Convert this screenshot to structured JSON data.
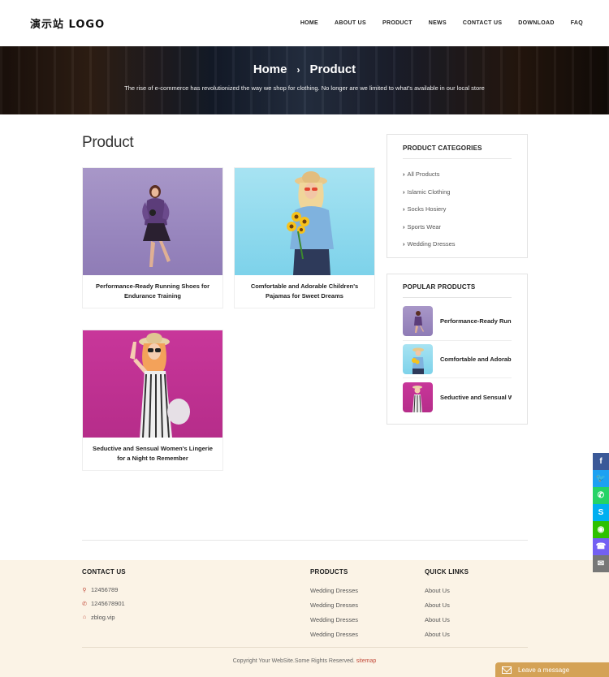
{
  "header": {
    "logo": "演示站 LOGO",
    "nav": [
      "HOME",
      "ABOUT US",
      "PRODUCT",
      "NEWS",
      "CONTACT US",
      "DOWNLOAD",
      "FAQ"
    ]
  },
  "banner": {
    "crumb_home": "Home",
    "crumb_sep": "›",
    "crumb_current": "Product",
    "subtitle": "The rise of e-commerce has revolutionized the way we shop for clothing. No longer are we limited to what's available in our local store"
  },
  "main": {
    "title": "Product",
    "products": [
      {
        "caption": "Performance-Ready Running Shoes for Endurance Training",
        "image": "woman-in-purple-coat-photo"
      },
      {
        "caption": "Comfortable and Adorable Children's Pajamas for Sweet Dreams",
        "image": "woman-with-sunflowers-photo"
      },
      {
        "caption": "Seductive and Sensual Women's Lingerie for a Night to Remember",
        "image": "woman-in-striped-jumpsuit-photo"
      }
    ]
  },
  "sidebar": {
    "categories_title": "PRODUCT CATEGORIES",
    "categories": [
      "All Products",
      "Islamic Clothing",
      "Socks Hosiery",
      "Sports Wear",
      "Wedding Dresses"
    ],
    "popular_title": "POPULAR PRODUCTS",
    "popular": [
      {
        "title": "Performance-Ready Running Shoes for Endurance Training"
      },
      {
        "title": "Comfortable and Adorable Children's Pajamas for Sweet Dreams"
      },
      {
        "title": "Seductive and Sensual Women's Lingerie for a Night to Remember"
      }
    ]
  },
  "footer": {
    "contact_title": "CONTACT US",
    "contact": [
      {
        "icon": "location-pin-icon",
        "text": "12456789"
      },
      {
        "icon": "phone-icon",
        "text": "1245678901"
      },
      {
        "icon": "home-icon",
        "text": "zblog.vip"
      }
    ],
    "products_title": "PRODUCTS",
    "products": [
      "Wedding Dresses",
      "Wedding Dresses",
      "Wedding Dresses",
      "Wedding Dresses"
    ],
    "links_title": "QUICK LINKS",
    "links": [
      "About Us",
      "About Us",
      "About Us",
      "About Us"
    ],
    "copyright": "Copyright Your WebSite.Some Rights Reserved.",
    "sitemap": "sitemap"
  },
  "social": [
    {
      "icon": "facebook-icon",
      "glyph": "f",
      "color": "#3b5998"
    },
    {
      "icon": "twitter-icon",
      "glyph": "🐦",
      "color": "#1da1f2"
    },
    {
      "icon": "whatsapp-icon",
      "glyph": "✆",
      "color": "#25d366"
    },
    {
      "icon": "skype-icon",
      "glyph": "S",
      "color": "#00aff0"
    },
    {
      "icon": "wechat-icon",
      "glyph": "◉",
      "color": "#2dc100"
    },
    {
      "icon": "viber-icon",
      "glyph": "☎",
      "color": "#7360f2"
    },
    {
      "icon": "email-icon",
      "glyph": "✉",
      "color": "#777777"
    }
  ],
  "leave_message": "Leave a message"
}
